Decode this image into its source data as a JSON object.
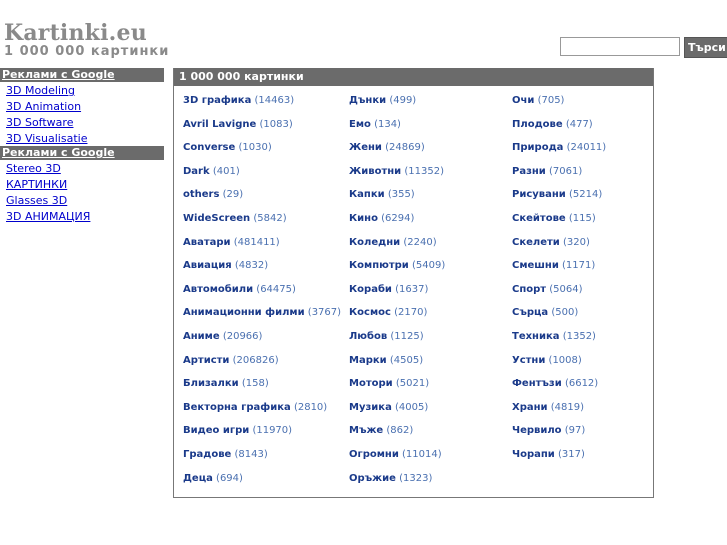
{
  "logo": {
    "title": "Kartinki.eu",
    "subtitle": "1 000 000 картинки"
  },
  "search": {
    "value": "",
    "button_label": "Търси"
  },
  "sidebar": {
    "groups": [
      {
        "heading": "Реклами с Google",
        "links": [
          "3D Modeling",
          "3D Animation",
          "3D Software",
          "3D Visualisatie"
        ]
      },
      {
        "heading": "Реклами с Google",
        "links": [
          "Stereo 3D",
          "КАРТИНКИ",
          "Glasses 3D",
          "3D АНИМАЦИЯ"
        ]
      }
    ]
  },
  "panel": {
    "title": "1 000 000 картинки",
    "columns": [
      [
        {
          "name": "3D графика",
          "count": "(14463)"
        },
        {
          "name": "Avril Lavigne",
          "count": "(1083)"
        },
        {
          "name": "Converse",
          "count": "(1030)"
        },
        {
          "name": "Dark",
          "count": "(401)"
        },
        {
          "name": "others",
          "count": "(29)"
        },
        {
          "name": "WideScreen",
          "count": "(5842)"
        },
        {
          "name": "Аватари",
          "count": "(481411)"
        },
        {
          "name": "Авиация",
          "count": "(4832)"
        },
        {
          "name": "Автомобили",
          "count": "(64475)"
        },
        {
          "name": "Анимационни филми",
          "count": "(3767)"
        },
        {
          "name": "Аниме",
          "count": "(20966)"
        },
        {
          "name": "Артисти",
          "count": "(206826)"
        },
        {
          "name": "Близалки",
          "count": "(158)"
        },
        {
          "name": "Векторна графика",
          "count": "(2810)"
        },
        {
          "name": "Видео игри",
          "count": "(11970)"
        },
        {
          "name": "Градове",
          "count": "(8143)"
        },
        {
          "name": "Деца",
          "count": "(694)"
        }
      ],
      [
        {
          "name": "Дънки",
          "count": "(499)"
        },
        {
          "name": "Емо",
          "count": "(134)"
        },
        {
          "name": "Жени",
          "count": "(24869)"
        },
        {
          "name": "Животни",
          "count": "(11352)"
        },
        {
          "name": "Капки",
          "count": "(355)"
        },
        {
          "name": "Кино",
          "count": "(6294)"
        },
        {
          "name": "Коледни",
          "count": "(2240)"
        },
        {
          "name": "Компютри",
          "count": "(5409)"
        },
        {
          "name": "Кораби",
          "count": "(1637)"
        },
        {
          "name": "Космос",
          "count": "(2170)"
        },
        {
          "name": "Любов",
          "count": "(1125)"
        },
        {
          "name": "Марки",
          "count": "(4505)"
        },
        {
          "name": "Мотори",
          "count": "(5021)"
        },
        {
          "name": "Музика",
          "count": "(4005)"
        },
        {
          "name": "Мъже",
          "count": "(862)"
        },
        {
          "name": "Огромни",
          "count": "(11014)"
        },
        {
          "name": "Оръжие",
          "count": "(1323)"
        }
      ],
      [
        {
          "name": "Очи",
          "count": "(705)"
        },
        {
          "name": "Плодове",
          "count": "(477)"
        },
        {
          "name": "Природа",
          "count": "(24011)"
        },
        {
          "name": "Разни",
          "count": "(7061)"
        },
        {
          "name": "Рисувани",
          "count": "(5214)"
        },
        {
          "name": "Скейтове",
          "count": "(115)"
        },
        {
          "name": "Скелети",
          "count": "(320)"
        },
        {
          "name": "Смешни",
          "count": "(1171)"
        },
        {
          "name": "Спорт",
          "count": "(5064)"
        },
        {
          "name": "Сърца",
          "count": "(500)"
        },
        {
          "name": "Техника",
          "count": "(1352)"
        },
        {
          "name": "Устни",
          "count": "(1008)"
        },
        {
          "name": "Фентъзи",
          "count": "(6612)"
        },
        {
          "name": "Храни",
          "count": "(4819)"
        },
        {
          "name": "Червило",
          "count": "(97)"
        },
        {
          "name": "Чорапи",
          "count": "(317)"
        }
      ]
    ]
  }
}
